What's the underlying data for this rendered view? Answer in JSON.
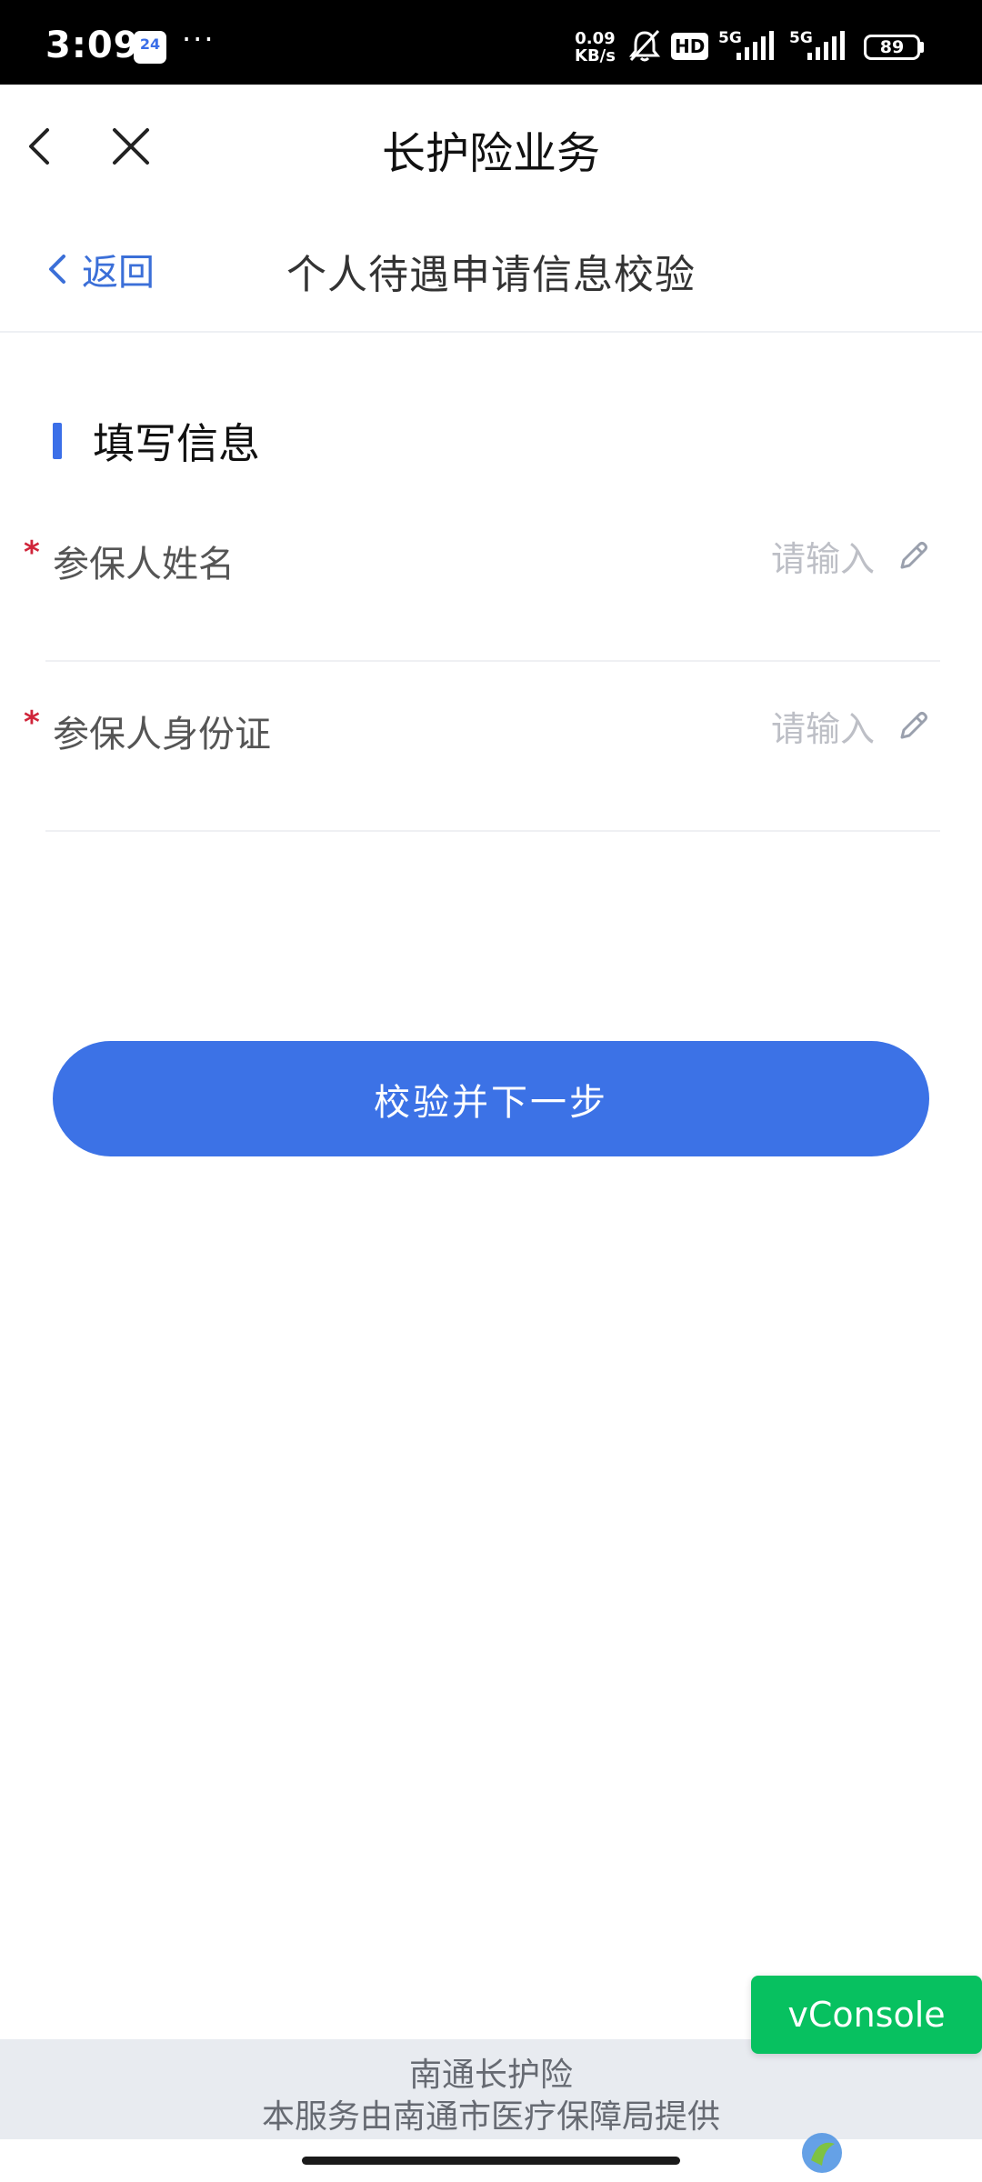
{
  "status_bar": {
    "time": "3:09",
    "calendar_badge": "24",
    "more": "···",
    "net_speed_value": "0.09",
    "net_speed_unit": "KB/s",
    "hd": "HD",
    "sim1": "5G",
    "sim2": "5G",
    "battery": "89"
  },
  "navbar": {
    "title": "长护险业务",
    "back_icon": "chevron-left-icon",
    "close_icon": "close-icon"
  },
  "subheader": {
    "back_label": "返回",
    "title": "个人待遇申请信息校验"
  },
  "section": {
    "title": "填写信息",
    "accent_color": "#3b6fe8"
  },
  "form": {
    "fields": [
      {
        "label": "参保人姓名",
        "value": "",
        "placeholder": "请输入",
        "required_mark": "*"
      },
      {
        "label": "参保人身份证",
        "value": "",
        "placeholder": "请输入",
        "required_mark": "*"
      }
    ],
    "submit_label": "校验并下一步",
    "primary_color": "#3c72e6"
  },
  "footer": {
    "line1": "南通长护险",
    "line2": "本服务由南通市医疗保障局提供"
  },
  "vconsole": {
    "label": "vConsole",
    "color": "#07c160"
  }
}
